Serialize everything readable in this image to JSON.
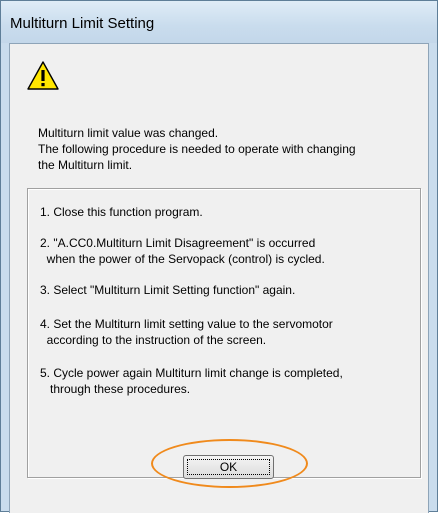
{
  "dialog": {
    "title": "Multiturn Limit Setting",
    "icon": "warning-triangle-icon",
    "message_lines": [
      "Multiturn limit value was changed.",
      "The following procedure is needed to operate with changing",
      "the Multiturn limit."
    ],
    "steps": [
      [
        "1. Close this function program."
      ],
      [
        "2. \"A.CC0.Multiturn Limit Disagreement\" is occurred",
        "  when the power of the Servopack (control) is cycled."
      ],
      [
        "3. Select  \"Multiturn Limit Setting function\" again."
      ],
      [
        "4. Set the Multiturn limit setting value to the servomotor",
        "  according to the instruction of the screen."
      ],
      [
        "5. Cycle power again Multiturn limit change is completed,",
        "   through these procedures."
      ]
    ],
    "ok_label": "OK",
    "colors": {
      "titlebar": "#c9dced",
      "client": "#f0f0f0",
      "highlight": "#f08a1c",
      "warning_fill": "#ffe600"
    }
  }
}
